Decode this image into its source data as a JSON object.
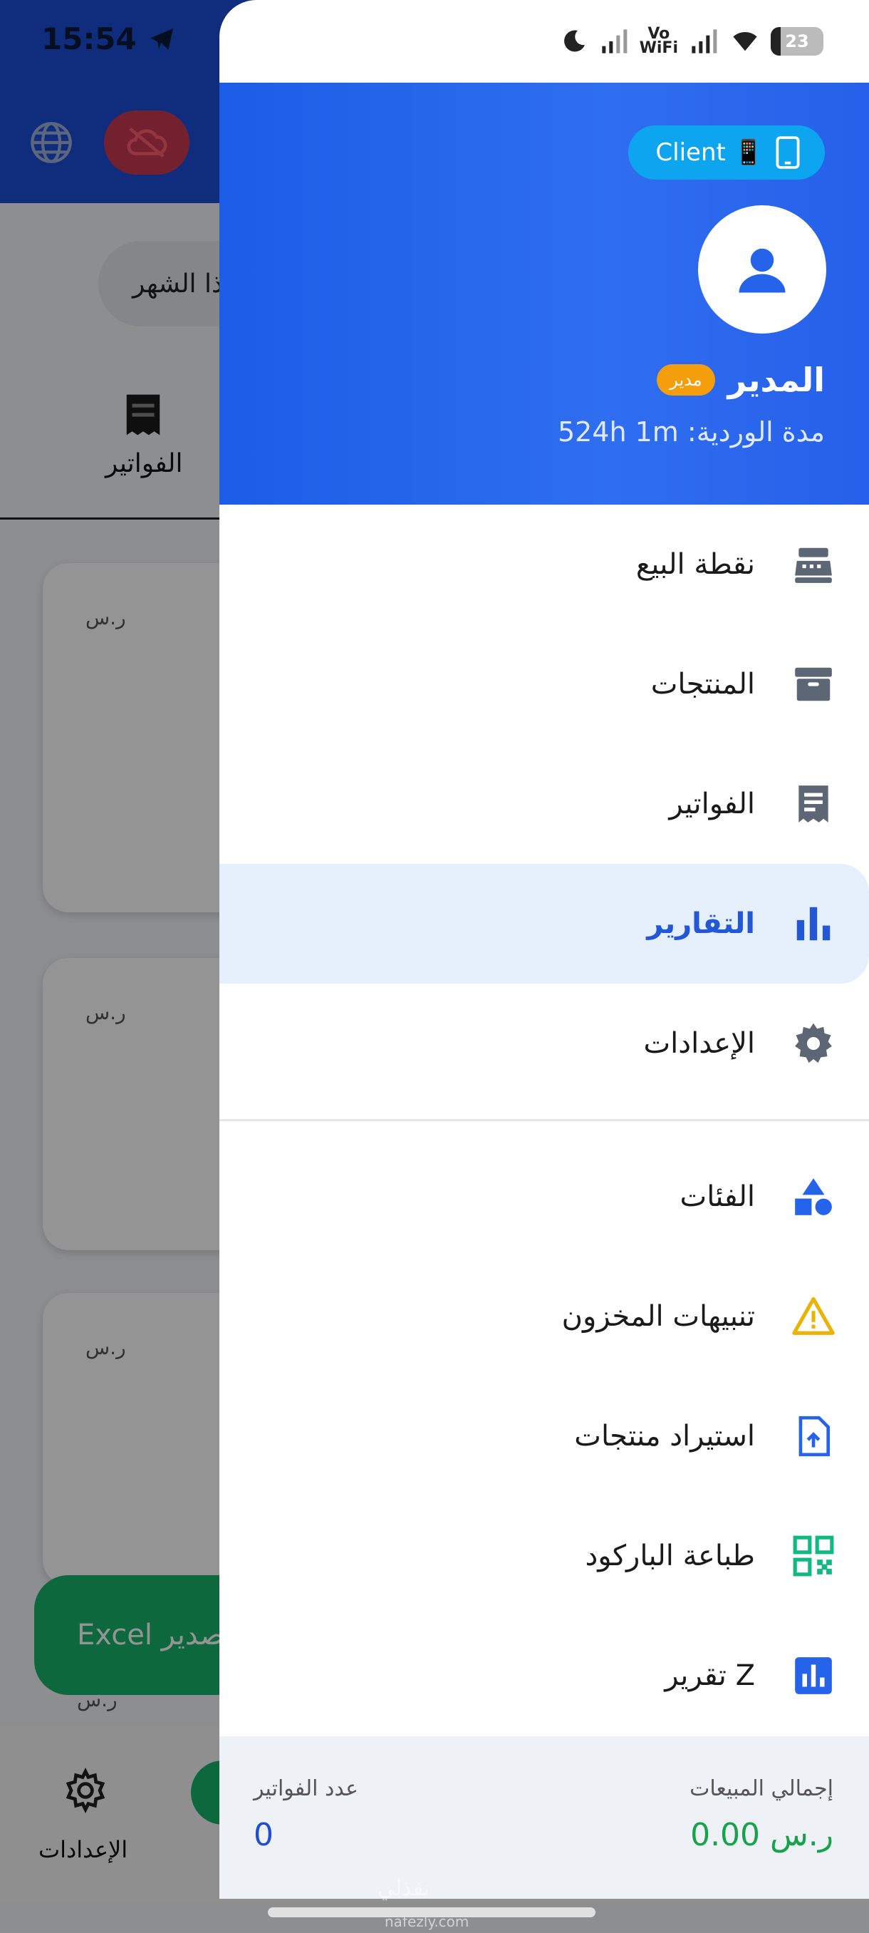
{
  "background": {
    "time": "15:54",
    "filter_pill": "ذا الشهر",
    "invoices_tab": "الفواتير",
    "currency": "ر.س",
    "excel_button": "Excel تصدير",
    "nav_settings": "الإعدادات"
  },
  "status_bar": {
    "vowifi": "Vo\nWiFi",
    "battery": "23"
  },
  "drawer": {
    "client_chip": "Client 📱",
    "user_name": "المدير",
    "role_badge": "مدير",
    "shift_duration": "مدة الوردية: 524h 1m",
    "menu": [
      {
        "label": "نقطة البيع",
        "icon": "cash-register-icon"
      },
      {
        "label": "المنتجات",
        "icon": "archive-box-icon"
      },
      {
        "label": "الفواتير",
        "icon": "receipt-icon"
      },
      {
        "label": "التقارير",
        "icon": "bar-chart-icon",
        "active": true
      },
      {
        "label": "الإعدادات",
        "icon": "gear-icon"
      }
    ],
    "menu2": [
      {
        "label": "الفئات",
        "icon": "shapes-icon"
      },
      {
        "label": "تنبيهات المخزون",
        "icon": "warning-icon"
      },
      {
        "label": "استيراد منتجات",
        "icon": "file-upload-icon"
      },
      {
        "label": "طباعة الباركود",
        "icon": "qr-code-icon"
      },
      {
        "label": "تقرير Z",
        "icon": "z-report-icon"
      }
    ],
    "summary": {
      "total_sales_label": "إجمالي المبيعات",
      "total_sales_value": "0.00 ر.س",
      "invoice_count_label": "عدد الفواتير",
      "invoice_count_value": "0"
    }
  },
  "watermark": {
    "text": "نفذلي",
    "url": "nafezly.com"
  },
  "colors": {
    "primary": "#2660ea",
    "active_bg": "#e6effc",
    "success": "#16a34a",
    "warning": "#f59e0b",
    "client_chip": "#0ea5f0"
  }
}
